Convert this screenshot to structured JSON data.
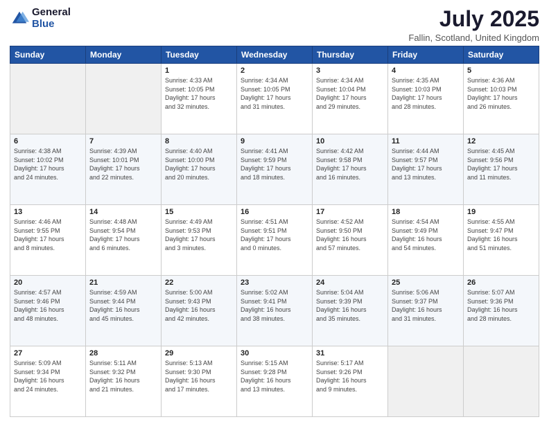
{
  "header": {
    "logo_line1": "General",
    "logo_line2": "Blue",
    "month": "July 2025",
    "location": "Fallin, Scotland, United Kingdom"
  },
  "weekdays": [
    "Sunday",
    "Monday",
    "Tuesday",
    "Wednesday",
    "Thursday",
    "Friday",
    "Saturday"
  ],
  "weeks": [
    [
      {
        "day": "",
        "info": ""
      },
      {
        "day": "",
        "info": ""
      },
      {
        "day": "1",
        "info": "Sunrise: 4:33 AM\nSunset: 10:05 PM\nDaylight: 17 hours\nand 32 minutes."
      },
      {
        "day": "2",
        "info": "Sunrise: 4:34 AM\nSunset: 10:05 PM\nDaylight: 17 hours\nand 31 minutes."
      },
      {
        "day": "3",
        "info": "Sunrise: 4:34 AM\nSunset: 10:04 PM\nDaylight: 17 hours\nand 29 minutes."
      },
      {
        "day": "4",
        "info": "Sunrise: 4:35 AM\nSunset: 10:03 PM\nDaylight: 17 hours\nand 28 minutes."
      },
      {
        "day": "5",
        "info": "Sunrise: 4:36 AM\nSunset: 10:03 PM\nDaylight: 17 hours\nand 26 minutes."
      }
    ],
    [
      {
        "day": "6",
        "info": "Sunrise: 4:38 AM\nSunset: 10:02 PM\nDaylight: 17 hours\nand 24 minutes."
      },
      {
        "day": "7",
        "info": "Sunrise: 4:39 AM\nSunset: 10:01 PM\nDaylight: 17 hours\nand 22 minutes."
      },
      {
        "day": "8",
        "info": "Sunrise: 4:40 AM\nSunset: 10:00 PM\nDaylight: 17 hours\nand 20 minutes."
      },
      {
        "day": "9",
        "info": "Sunrise: 4:41 AM\nSunset: 9:59 PM\nDaylight: 17 hours\nand 18 minutes."
      },
      {
        "day": "10",
        "info": "Sunrise: 4:42 AM\nSunset: 9:58 PM\nDaylight: 17 hours\nand 16 minutes."
      },
      {
        "day": "11",
        "info": "Sunrise: 4:44 AM\nSunset: 9:57 PM\nDaylight: 17 hours\nand 13 minutes."
      },
      {
        "day": "12",
        "info": "Sunrise: 4:45 AM\nSunset: 9:56 PM\nDaylight: 17 hours\nand 11 minutes."
      }
    ],
    [
      {
        "day": "13",
        "info": "Sunrise: 4:46 AM\nSunset: 9:55 PM\nDaylight: 17 hours\nand 8 minutes."
      },
      {
        "day": "14",
        "info": "Sunrise: 4:48 AM\nSunset: 9:54 PM\nDaylight: 17 hours\nand 6 minutes."
      },
      {
        "day": "15",
        "info": "Sunrise: 4:49 AM\nSunset: 9:53 PM\nDaylight: 17 hours\nand 3 minutes."
      },
      {
        "day": "16",
        "info": "Sunrise: 4:51 AM\nSunset: 9:51 PM\nDaylight: 17 hours\nand 0 minutes."
      },
      {
        "day": "17",
        "info": "Sunrise: 4:52 AM\nSunset: 9:50 PM\nDaylight: 16 hours\nand 57 minutes."
      },
      {
        "day": "18",
        "info": "Sunrise: 4:54 AM\nSunset: 9:49 PM\nDaylight: 16 hours\nand 54 minutes."
      },
      {
        "day": "19",
        "info": "Sunrise: 4:55 AM\nSunset: 9:47 PM\nDaylight: 16 hours\nand 51 minutes."
      }
    ],
    [
      {
        "day": "20",
        "info": "Sunrise: 4:57 AM\nSunset: 9:46 PM\nDaylight: 16 hours\nand 48 minutes."
      },
      {
        "day": "21",
        "info": "Sunrise: 4:59 AM\nSunset: 9:44 PM\nDaylight: 16 hours\nand 45 minutes."
      },
      {
        "day": "22",
        "info": "Sunrise: 5:00 AM\nSunset: 9:43 PM\nDaylight: 16 hours\nand 42 minutes."
      },
      {
        "day": "23",
        "info": "Sunrise: 5:02 AM\nSunset: 9:41 PM\nDaylight: 16 hours\nand 38 minutes."
      },
      {
        "day": "24",
        "info": "Sunrise: 5:04 AM\nSunset: 9:39 PM\nDaylight: 16 hours\nand 35 minutes."
      },
      {
        "day": "25",
        "info": "Sunrise: 5:06 AM\nSunset: 9:37 PM\nDaylight: 16 hours\nand 31 minutes."
      },
      {
        "day": "26",
        "info": "Sunrise: 5:07 AM\nSunset: 9:36 PM\nDaylight: 16 hours\nand 28 minutes."
      }
    ],
    [
      {
        "day": "27",
        "info": "Sunrise: 5:09 AM\nSunset: 9:34 PM\nDaylight: 16 hours\nand 24 minutes."
      },
      {
        "day": "28",
        "info": "Sunrise: 5:11 AM\nSunset: 9:32 PM\nDaylight: 16 hours\nand 21 minutes."
      },
      {
        "day": "29",
        "info": "Sunrise: 5:13 AM\nSunset: 9:30 PM\nDaylight: 16 hours\nand 17 minutes."
      },
      {
        "day": "30",
        "info": "Sunrise: 5:15 AM\nSunset: 9:28 PM\nDaylight: 16 hours\nand 13 minutes."
      },
      {
        "day": "31",
        "info": "Sunrise: 5:17 AM\nSunset: 9:26 PM\nDaylight: 16 hours\nand 9 minutes."
      },
      {
        "day": "",
        "info": ""
      },
      {
        "day": "",
        "info": ""
      }
    ]
  ]
}
